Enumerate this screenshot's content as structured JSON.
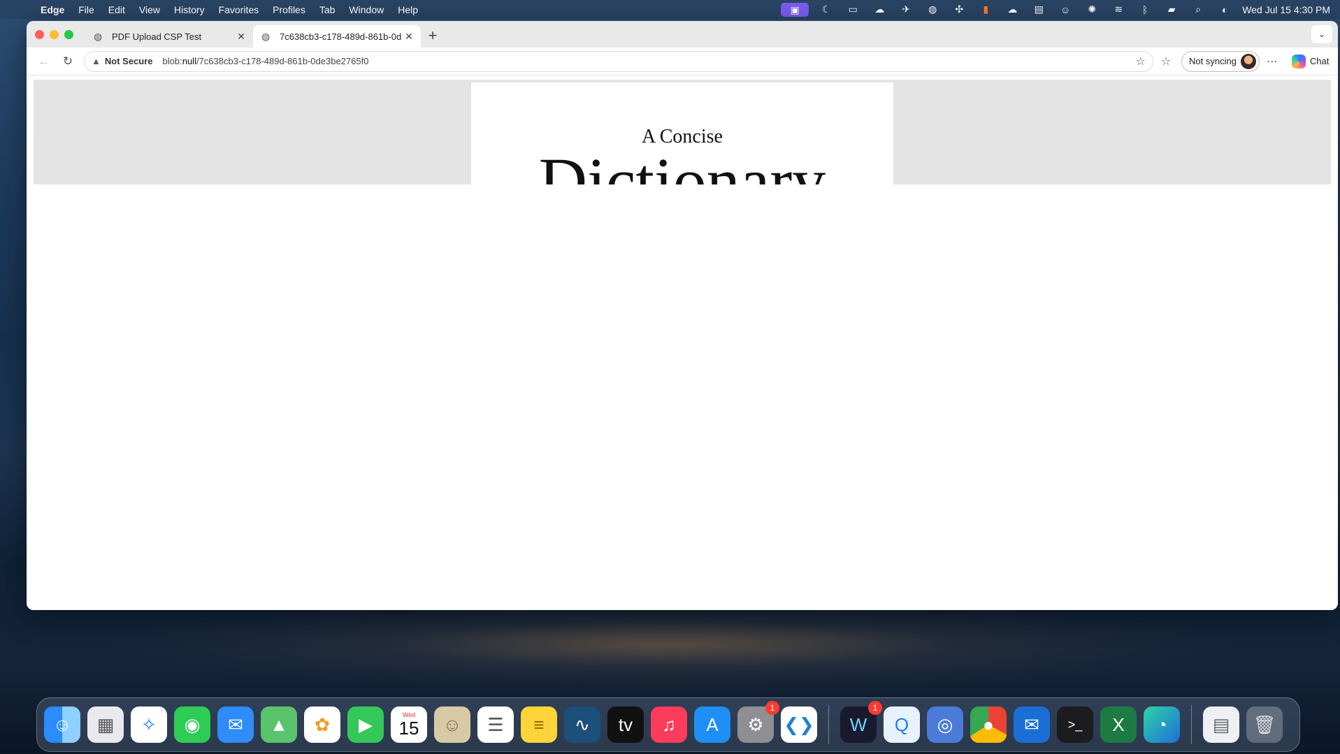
{
  "menubar": {
    "apple": "",
    "app": "Edge",
    "items": [
      "File",
      "Edit",
      "View",
      "History",
      "Favorites",
      "Profiles",
      "Tab",
      "Window",
      "Help"
    ],
    "clock": "Wed Jul 15  4:30 PM"
  },
  "browser": {
    "tabs": [
      {
        "title": "PDF Upload CSP Test",
        "active": false
      },
      {
        "title": "7c638cb3-c178-489d-861b-0d",
        "active": true
      }
    ],
    "new_tab_symbol": "+",
    "address": {
      "security_label": "Not Secure",
      "url_prefix": "blob:",
      "url_host": "null",
      "url_path": "/7c638cb3-c178-489d-861b-0de3be2765f0"
    },
    "sync_label": "Not syncing",
    "chat_label": "Chat"
  },
  "pdf": {
    "subtitle": "A Concise",
    "title_partial": "Dictionary"
  },
  "dock": {
    "calendar_month": "Wed",
    "calendar_day": "15",
    "badge_settings": "1",
    "badge_webex": "1"
  },
  "colors": {
    "accent_purple": "#7a5cf0",
    "badge_red": "#ff3b30",
    "pdf_background": "#e4e4e4"
  }
}
